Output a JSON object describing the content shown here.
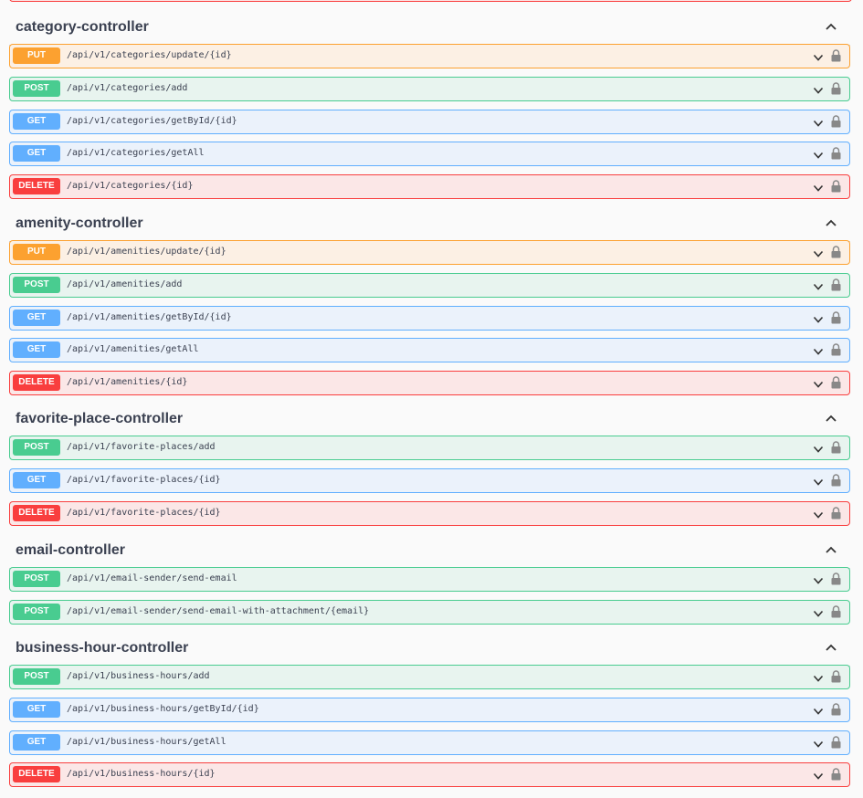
{
  "sections": [
    {
      "name": "category-controller",
      "operations": [
        {
          "method": "PUT",
          "path": "/api/v1/categories/update/{id}"
        },
        {
          "method": "POST",
          "path": "/api/v1/categories/add"
        },
        {
          "method": "GET",
          "path": "/api/v1/categories/getById/{id}"
        },
        {
          "method": "GET",
          "path": "/api/v1/categories/getAll"
        },
        {
          "method": "DELETE",
          "path": "/api/v1/categories/{id}"
        }
      ]
    },
    {
      "name": "amenity-controller",
      "operations": [
        {
          "method": "PUT",
          "path": "/api/v1/amenities/update/{id}"
        },
        {
          "method": "POST",
          "path": "/api/v1/amenities/add"
        },
        {
          "method": "GET",
          "path": "/api/v1/amenities/getById/{id}"
        },
        {
          "method": "GET",
          "path": "/api/v1/amenities/getAll"
        },
        {
          "method": "DELETE",
          "path": "/api/v1/amenities/{id}"
        }
      ]
    },
    {
      "name": "favorite-place-controller",
      "operations": [
        {
          "method": "POST",
          "path": "/api/v1/favorite-places/add"
        },
        {
          "method": "GET",
          "path": "/api/v1/favorite-places/{id}"
        },
        {
          "method": "DELETE",
          "path": "/api/v1/favorite-places/{id}"
        }
      ]
    },
    {
      "name": "email-controller",
      "operations": [
        {
          "method": "POST",
          "path": "/api/v1/email-sender/send-email"
        },
        {
          "method": "POST",
          "path": "/api/v1/email-sender/send-email-with-attachment/{email}"
        }
      ]
    },
    {
      "name": "business-hour-controller",
      "operations": [
        {
          "method": "POST",
          "path": "/api/v1/business-hours/add"
        },
        {
          "method": "GET",
          "path": "/api/v1/business-hours/getById/{id}"
        },
        {
          "method": "GET",
          "path": "/api/v1/business-hours/getAll"
        },
        {
          "method": "DELETE",
          "path": "/api/v1/business-hours/{id}"
        }
      ]
    }
  ],
  "colors": {
    "put": "#fca130",
    "post": "#49cc90",
    "get": "#61affe",
    "delete": "#f93e3e"
  },
  "icons": {
    "section_toggle": "chevron-up-icon",
    "operation_expand": "chevron-down-icon",
    "operation_auth": "lock-icon"
  }
}
